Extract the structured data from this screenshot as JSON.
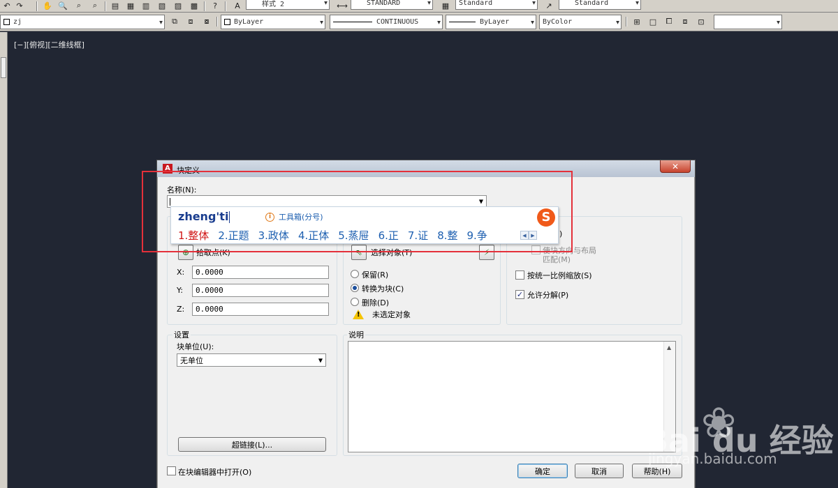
{
  "toolbar_top": {
    "text_style": "样式 2",
    "dim_style": "STANDARD",
    "table_style": "Standard",
    "multileader_style": "Standard"
  },
  "toolbar_layers": {
    "layer": "zj",
    "color": "ByLayer",
    "linetype": "CONTINUOUS",
    "lineweight": "ByLayer",
    "plotstyle": "ByColor"
  },
  "viewport_label": "[−][俯视][二维线框]",
  "dialog": {
    "title": "块定义",
    "close_glyph": "✕",
    "name_label": "名称(N):",
    "base_point": {
      "pick_label": "拾取点(K)",
      "x_label": "X:",
      "x_value": "0.0000",
      "y_label": "Y:",
      "y_value": "0.0000",
      "z_label": "Z:",
      "z_value": "0.0000"
    },
    "objects": {
      "select_label": "选择对象(T)",
      "retain": "保留(R)",
      "convert": "转换为块(C)",
      "delete": "删除(D)",
      "none_selected": "未选定对象"
    },
    "behavior": {
      "partial_label": ")",
      "match_orientation": "使块方向与布局",
      "match_suffix": "匹配(M)",
      "scale_uniformly": "按统一比例缩放(S)",
      "allow_explode": "允许分解(P)",
      "allow_explode_checked": true
    },
    "settings": {
      "title": "设置",
      "unit_label": "块单位(U):",
      "unit_value": "无单位",
      "hyperlink_button": "超链接(L)..."
    },
    "description_title": "说明",
    "open_in_editor": "在块编辑器中打开(O)",
    "ok_button": "确定",
    "cancel_button": "取消",
    "help_button": "帮助(H)"
  },
  "ime": {
    "pinyin": "zheng'ti",
    "tip": "工具箱(分号)",
    "logo": "S",
    "candidates": [
      "1.整体",
      "2.正题",
      "3.政体",
      "4.正体",
      "5.蒸屉",
      "6.正",
      "7.证",
      "8.整",
      "9.争"
    ],
    "prev_glyph": "◀",
    "next_glyph": "▶"
  },
  "watermark": {
    "brand": "Bai du 经验",
    "site": "jingyan.baidu.com"
  },
  "colors": {
    "canvas": "#212633",
    "annotation": "#e4303a",
    "ime_highlight": "#d01616",
    "ime_text": "#1d5fb0"
  }
}
